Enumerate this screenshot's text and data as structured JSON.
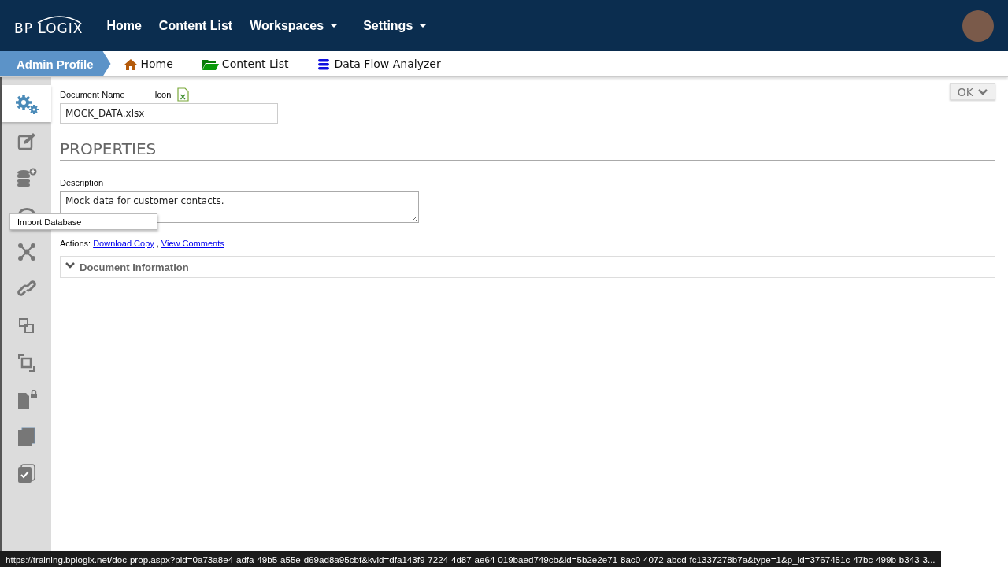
{
  "top_nav": {
    "logo": "BP LOGIX",
    "items": [
      {
        "label": "Home",
        "dropdown": false
      },
      {
        "label": "Content List",
        "dropdown": false
      },
      {
        "label": "Workspaces",
        "dropdown": true
      },
      {
        "label": "Settings",
        "dropdown": true
      }
    ]
  },
  "breadcrumb": {
    "profile": "Admin Profile",
    "links": [
      {
        "label": "Home",
        "kind": "home"
      },
      {
        "label": "Content List",
        "kind": "folder"
      },
      {
        "label": "Data Flow Analyzer",
        "kind": "database"
      }
    ]
  },
  "sidebar": {
    "items": [
      {
        "selected": true
      },
      {
        "selected": false
      },
      {
        "selected": false
      },
      {
        "selected": false
      },
      {
        "selected": false
      },
      {
        "selected": false
      },
      {
        "selected": false
      },
      {
        "selected": false
      },
      {
        "selected": false
      },
      {
        "selected": false
      },
      {
        "selected": false
      }
    ],
    "tooltip": "Import Database"
  },
  "form": {
    "document_name_label": "Document Name",
    "icon_label": "Icon",
    "document_name": "MOCK_DATA.xlsx",
    "ok_button": "OK",
    "section_title": "PROPERTIES",
    "description_label": "Description",
    "description": "Mock data for customer contacts.",
    "actions_label": "Actions:",
    "actions": [
      "Download Copy",
      "View Comments"
    ],
    "actions_separator": ",",
    "panel": {
      "title": "Document Information",
      "expanded": false
    }
  },
  "status_bar": "https://training.bplogix.net/doc-prop.aspx?pid=0a73a8e4-adfa-49b5-a55e-d69ad8a95cbf&kvid=dfa143f9-7224-4d87-ae64-019baed749cb&id=5b2e2e71-8ac0-4072-abcd-fc1337278b7a&type=1&p_id=3767451c-47bc-499b-b343-3..."
}
